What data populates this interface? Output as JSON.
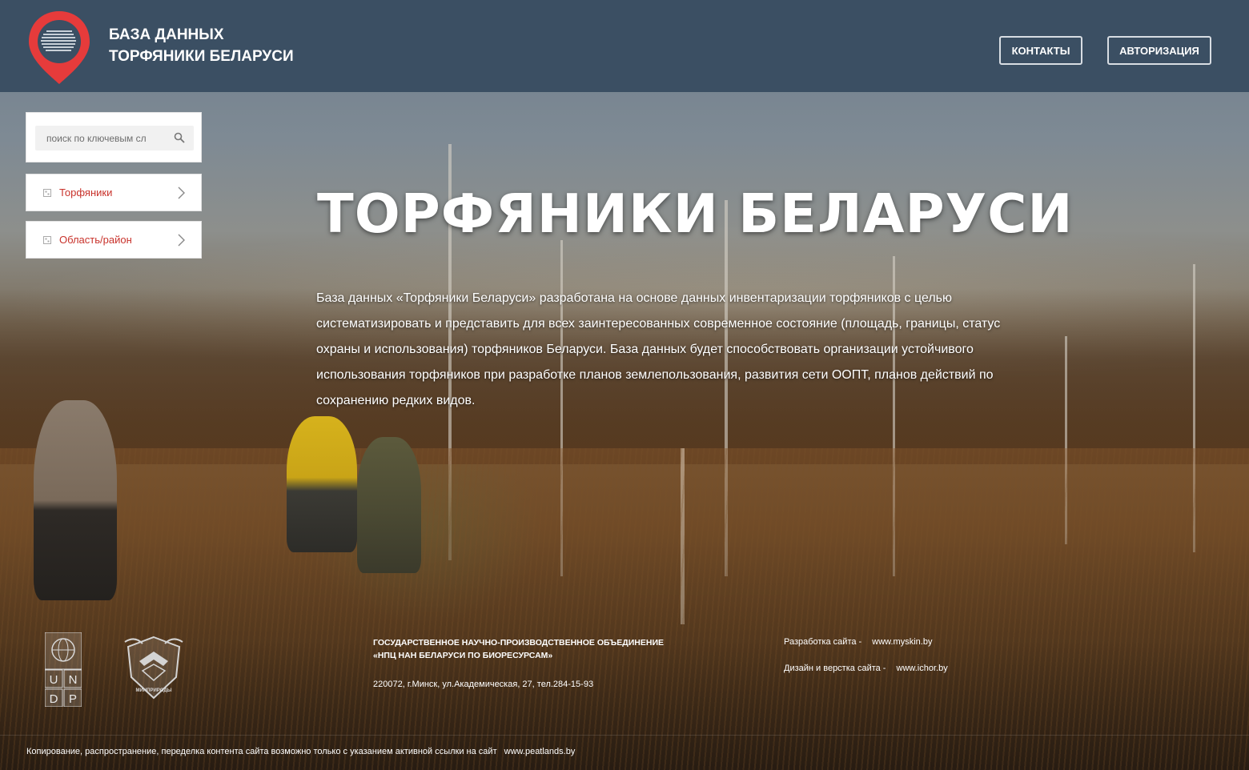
{
  "header": {
    "site_name_line1": "БАЗА ДАННЫХ",
    "site_name_line2": "ТОРФЯНИКИ БЕЛАРУСИ",
    "contacts_label": "КОНТАКТЫ",
    "auth_label": "АВТОРИЗАЦИЯ",
    "logo_color": "#e63b3b",
    "bar_color": "#3b4f63"
  },
  "sidebar": {
    "search": {
      "placeholder": "поиск по ключевым сл",
      "icon": "search-icon"
    },
    "items": [
      {
        "label": "Торфяники",
        "icon": "grid-bullet-icon"
      },
      {
        "label": "Область/район",
        "icon": "grid-bullet-icon"
      }
    ],
    "accent": "#c8322b"
  },
  "main": {
    "title": "ТОРФЯНИКИ БЕЛАРУСИ",
    "intro": "База данных «Торфяники Беларуси» разработана на основе данных инвентаризации торфяников с целью систематизировать и представить для всех заинтересованных современное состояние (площадь, границы, статус охраны и использования) торфяников Беларуси. База данных будет способствовать организации устойчивого использования торфяников при разработке планов землепользования, развития сети ООПТ, планов действий по сохранению редких видов."
  },
  "footer": {
    "undp_letters": [
      "U",
      "N",
      "D",
      "P"
    ],
    "ministry_logo_text": "МИНПРИРОДЫ",
    "org_line1": "ГОСУДАРСТВЕННОЕ НАУЧНО-ПРОИЗВОДСТВЕННОЕ ОБЪЕДИНЕНИЕ",
    "org_line2": "«НПЦ НАН БЕЛАРУСИ ПО БИОРЕСУРСАМ»",
    "address": "220072, г.Минск, ул.Академическая, 27, тел.284-15-93",
    "dev_label": "Разработка сайта -",
    "dev_link": "www.myskin.by",
    "design_label": "Дизайн и верстка сайта -",
    "design_link": "www.ichor.by",
    "copyright_text": "Копирование, распространение, переделка контента сайта возможно только с указанием активной ссылки на сайт",
    "copyright_link": "www.peatlands.by"
  }
}
